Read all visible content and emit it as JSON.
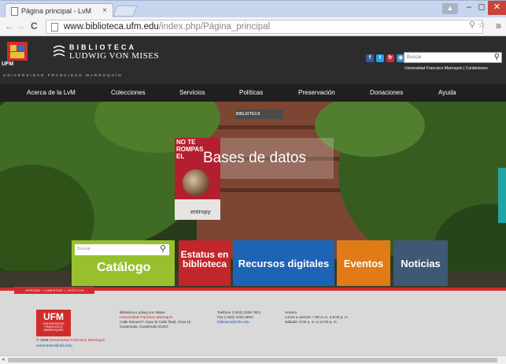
{
  "browser": {
    "tab_title": "Página principal - LvM",
    "tab_close": "×",
    "url_domain": "www.biblioteca.ufm.edu",
    "url_path": "/index.php/Página_principal",
    "window_min": "–",
    "window_max": "◻",
    "window_close": "✕"
  },
  "header": {
    "ufm_label": "UFM",
    "lib_line1": "BIBLIOTECA",
    "lib_line2": "LUDWIG VON MISES",
    "tagline": "UNIVERSIDAD FRANCISCO MARROQUÍN",
    "search_placeholder": "Buscar",
    "univ_link": "Universidad Francisco Marroquín | Contáctenos"
  },
  "nav": {
    "items": [
      "Acerca de la LvM",
      "Colecciones",
      "Servicios",
      "Políticas",
      "Preservación",
      "Donaciones",
      "Ayuda"
    ]
  },
  "hero": {
    "overlay_title": "Bases de datos",
    "poster_line1": "NO TE",
    "poster_line2": "ROMPAS",
    "poster_line3": "EL",
    "poster_brand": "entropy",
    "sign_text": "BIBLIOTECA"
  },
  "tiles": {
    "catalog_search_placeholder": "Buscar",
    "catalogo": "Catálogo",
    "estatus_line1": "Estatus en",
    "estatus_line2": "biblioteca",
    "recursos": "Recursos digitales",
    "eventos": "Eventos",
    "noticias": "Noticias"
  },
  "footer": {
    "ribbon": "VERDAD • LIBERTAD • JUSTICIA",
    "logo_big": "UFM",
    "logo_small1": "UNIVERSIDAD",
    "logo_small2": "FRANCISCO",
    "logo_small3": "MARROQUÍN",
    "copyright_pre": "© 1998",
    "copyright_link": "Universidad Francisco Marroquín",
    "webmaster": "webmaster@ufm.edu",
    "addr1": "Biblioteca Ludwig von Mises",
    "addr2": "Universidad Francisco Marroquín",
    "addr3": "Calle Manuel F. Ayau (6 Calle final), zona 10",
    "addr4": "Guatemala, Guatemala 01010",
    "tel1": "Teléfono (+502) 2338-7921",
    "tel2": "Fax (+502) 2332-3820",
    "tel3": "biblioteca@ufm.edu",
    "hor1": "Horario",
    "hor2": "Lunes a viernes: 7:00 a. m. a 9:00 p. m.",
    "hor3": "Sábado: 8:00 a. m. a 12:00 p. m."
  },
  "colors": {
    "accent_red": "#d12c2c",
    "header_dark": "#2c2c2d",
    "catalog_green": "#98c02e",
    "recursos_blue": "#1d63b6",
    "eventos_orange": "#e07b17",
    "noticias_slate": "#3f5873"
  }
}
